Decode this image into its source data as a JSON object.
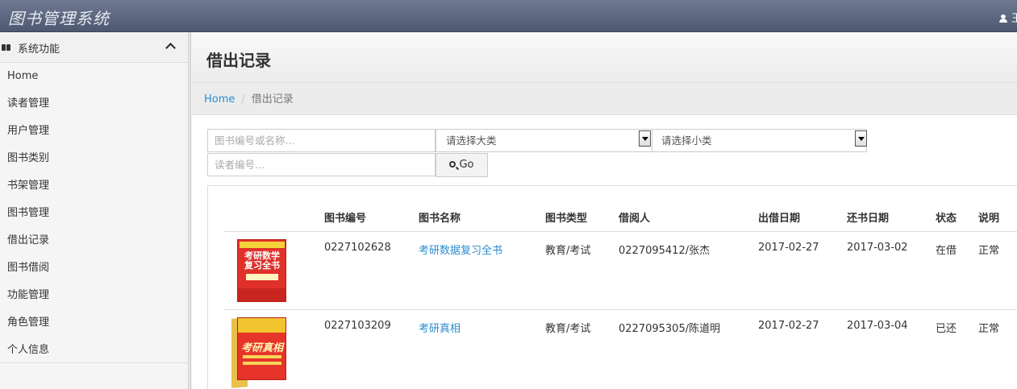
{
  "app": {
    "title": "图书管理系统",
    "user": "王"
  },
  "sidebar": {
    "header": "系统功能",
    "items": [
      {
        "label": "Home"
      },
      {
        "label": "读者管理"
      },
      {
        "label": "用户管理"
      },
      {
        "label": "图书类别"
      },
      {
        "label": "书架管理"
      },
      {
        "label": "图书管理"
      },
      {
        "label": "借出记录"
      },
      {
        "label": "图书借阅"
      },
      {
        "label": "功能管理"
      },
      {
        "label": "角色管理"
      },
      {
        "label": "个人信息"
      }
    ]
  },
  "page": {
    "title": "借出记录"
  },
  "breadcrumb": {
    "home": "Home",
    "current": "借出记录"
  },
  "filters": {
    "book_placeholder": "图书编号或名称...",
    "category_major": "请选择大类",
    "category_minor": "请选择小类",
    "reader_placeholder": "读者编号...",
    "go_label": "Go"
  },
  "table": {
    "headers": [
      "图书编号",
      "图书名称",
      "图书类型",
      "借阅人",
      "出借日期",
      "还书日期",
      "状态",
      "说明"
    ],
    "rows": [
      {
        "cover_text": "考研数学复习全书",
        "book_id": "0227102628",
        "book_name": "考研数据复习全书",
        "book_type": "教育/考试",
        "borrower": "0227095412/张杰",
        "borrow_date": "2017-02-27",
        "return_date": "2017-03-02",
        "status": "在借",
        "note": "正常"
      },
      {
        "cover_text": "考研真相",
        "book_id": "0227103209",
        "book_name": "考研真相",
        "book_type": "教育/考试",
        "borrower": "0227095305/陈道明",
        "borrow_date": "2017-02-27",
        "return_date": "2017-03-04",
        "status": "已还",
        "note": "正常"
      }
    ]
  }
}
